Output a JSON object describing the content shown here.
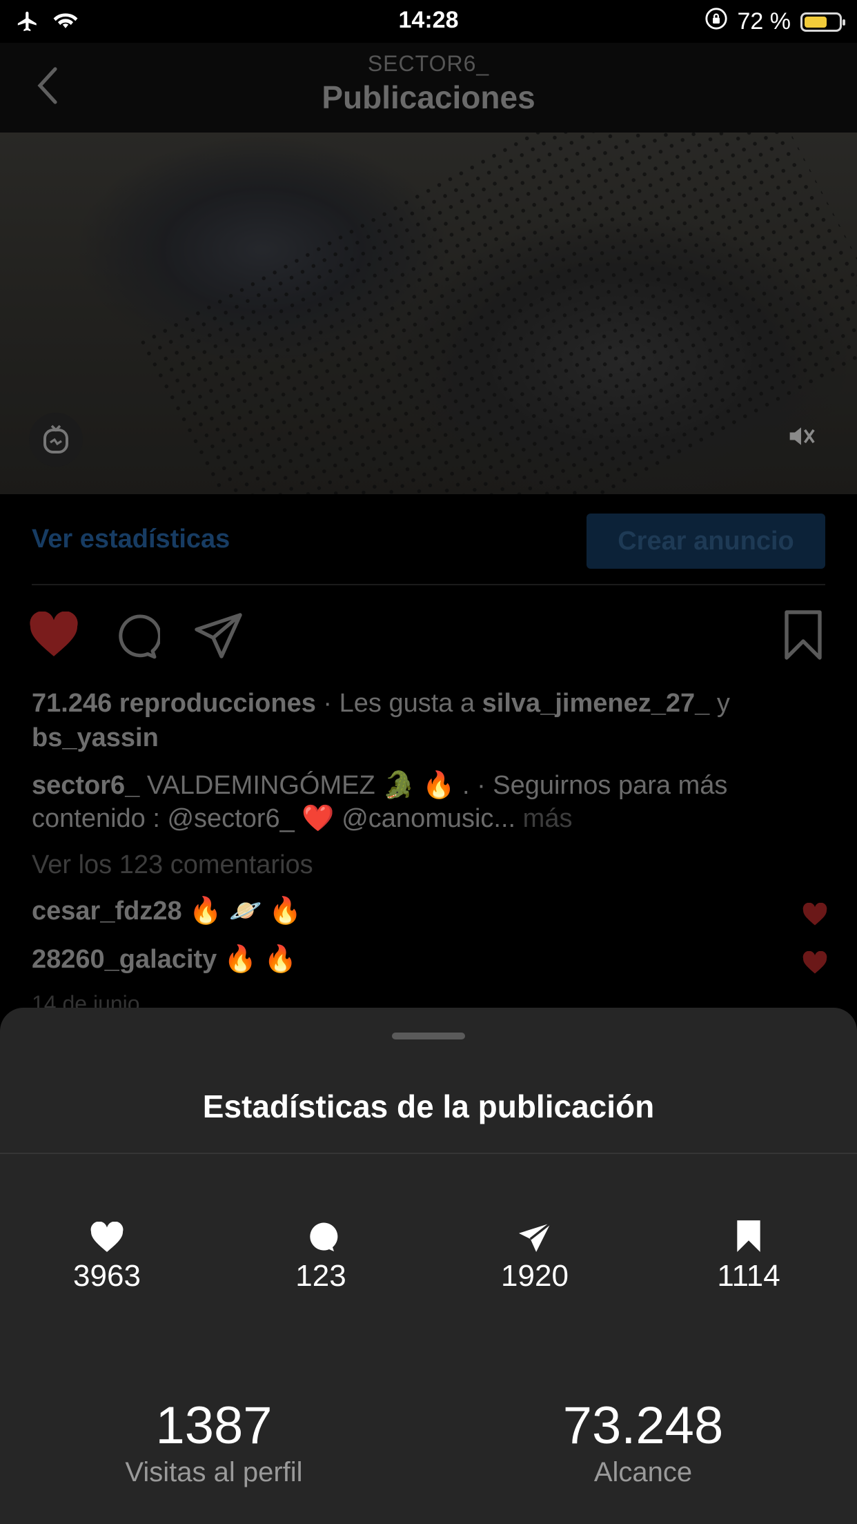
{
  "status_bar": {
    "time": "14:28",
    "battery": "72 %"
  },
  "header": {
    "account": "SECTOR6_",
    "title": "Publicaciones"
  },
  "post_actions": {
    "stats_link": "Ver estadísticas",
    "ad_button": "Crear anuncio"
  },
  "post": {
    "views": "71.246 reproducciones",
    "likes_prefix": "· Les gusta a",
    "liked_by_1": "silva_jimenez_27_",
    "and": "y",
    "liked_by_2": "bs_yassin",
    "caption_user": "sector6_",
    "caption_text_1": "VALDEMINGÓMEZ 🐊 🔥 . · Seguirnos para más",
    "caption_text_2": "contenido : @sector6_ ❤️ @canomusic...",
    "caption_more": "más",
    "view_comments": "Ver los 123 comentarios",
    "comments": [
      {
        "user": "cesar_fdz28",
        "text": "🔥 🪐 🔥"
      },
      {
        "user": "28260_galacity",
        "text": "🔥 🔥"
      }
    ],
    "date": "14 de junio"
  },
  "insights": {
    "title": "Estadísticas de la publicación",
    "likes": "3963",
    "comments": "123",
    "shares": "1920",
    "saves": "1114",
    "profile_visits": "1387",
    "profile_visits_label": "Visitas al perfil",
    "reach": "73.248",
    "reach_label": "Alcance"
  },
  "colors": {
    "battery": "#f2cc3a",
    "like_red": "#7a1c1c",
    "link_blue": "#173c63",
    "sheet_bg": "#262626"
  }
}
